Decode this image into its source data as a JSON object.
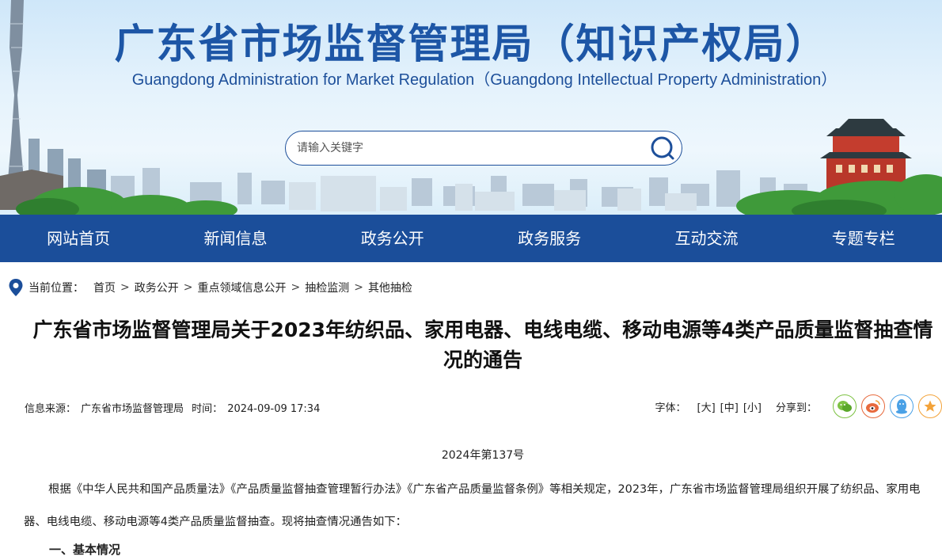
{
  "header": {
    "title": "广东省市场监督管理局（知识产权局）",
    "subtitle": "Guangdong Administration for Market Regulation（Guangdong Intellectual Property Administration）",
    "search_placeholder": "请输入关键字"
  },
  "nav": {
    "items": [
      "网站首页",
      "新闻信息",
      "政务公开",
      "政务服务",
      "互动交流",
      "专题专栏"
    ]
  },
  "breadcrumb": {
    "label": "当前位置：",
    "items": [
      "首页",
      "政务公开",
      "重点领域信息公开",
      "抽检监测",
      "其他抽检"
    ],
    "separator": ">"
  },
  "article": {
    "title": "广东省市场监督管理局关于2023年纺织品、家用电器、电线电缆、移动电源等4类产品质量监督抽查情况的通告",
    "source_label": "信息来源：",
    "source": "广东省市场监督管理局",
    "time_label": "时间：",
    "time": "2024-09-09 17:34",
    "font_label": "字体：",
    "font_options": [
      "[大]",
      "[中]",
      "[小]"
    ],
    "share_label": "分享到：",
    "doc_number": "2024年第137号",
    "paragraph": "根据《中华人民共和国产品质量法》《产品质量监督抽查管理暂行办法》《广东省产品质量监督条例》等相关规定，2023年，广东省市场监督管理局组织开展了纺织品、家用电器、电线电缆、移动电源等4类产品质量监督抽查。现将抽查情况通告如下：",
    "section_heading": "一、基本情况"
  },
  "colors": {
    "brand_blue": "#1b4e9a",
    "title_blue": "#1d56a6"
  }
}
